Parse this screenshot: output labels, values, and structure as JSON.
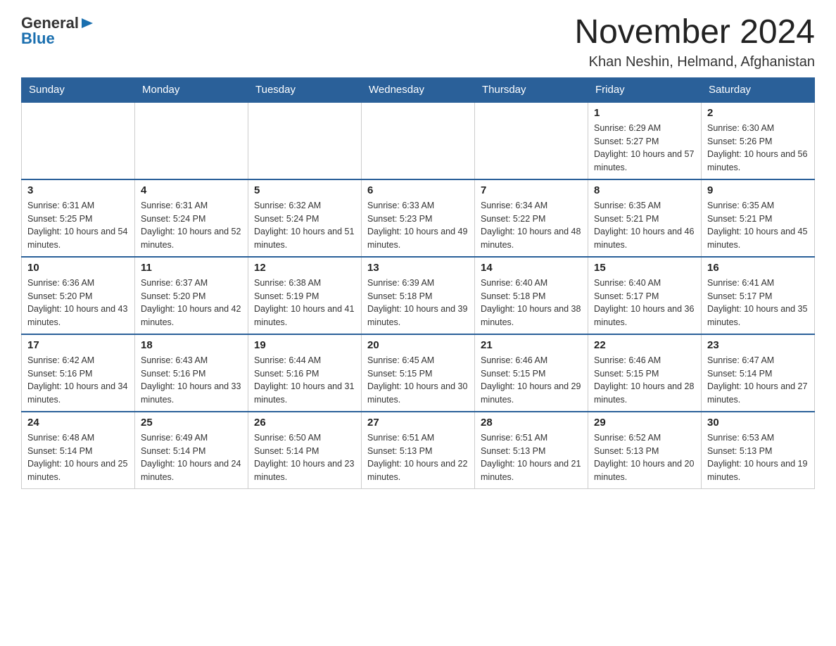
{
  "logo": {
    "general": "General",
    "arrow": "▶",
    "blue": "Blue"
  },
  "title": "November 2024",
  "subtitle": "Khan Neshin, Helmand, Afghanistan",
  "weekdays": [
    "Sunday",
    "Monday",
    "Tuesday",
    "Wednesday",
    "Thursday",
    "Friday",
    "Saturday"
  ],
  "weeks": [
    [
      {
        "day": "",
        "info": ""
      },
      {
        "day": "",
        "info": ""
      },
      {
        "day": "",
        "info": ""
      },
      {
        "day": "",
        "info": ""
      },
      {
        "day": "",
        "info": ""
      },
      {
        "day": "1",
        "info": "Sunrise: 6:29 AM\nSunset: 5:27 PM\nDaylight: 10 hours and 57 minutes."
      },
      {
        "day": "2",
        "info": "Sunrise: 6:30 AM\nSunset: 5:26 PM\nDaylight: 10 hours and 56 minutes."
      }
    ],
    [
      {
        "day": "3",
        "info": "Sunrise: 6:31 AM\nSunset: 5:25 PM\nDaylight: 10 hours and 54 minutes."
      },
      {
        "day": "4",
        "info": "Sunrise: 6:31 AM\nSunset: 5:24 PM\nDaylight: 10 hours and 52 minutes."
      },
      {
        "day": "5",
        "info": "Sunrise: 6:32 AM\nSunset: 5:24 PM\nDaylight: 10 hours and 51 minutes."
      },
      {
        "day": "6",
        "info": "Sunrise: 6:33 AM\nSunset: 5:23 PM\nDaylight: 10 hours and 49 minutes."
      },
      {
        "day": "7",
        "info": "Sunrise: 6:34 AM\nSunset: 5:22 PM\nDaylight: 10 hours and 48 minutes."
      },
      {
        "day": "8",
        "info": "Sunrise: 6:35 AM\nSunset: 5:21 PM\nDaylight: 10 hours and 46 minutes."
      },
      {
        "day": "9",
        "info": "Sunrise: 6:35 AM\nSunset: 5:21 PM\nDaylight: 10 hours and 45 minutes."
      }
    ],
    [
      {
        "day": "10",
        "info": "Sunrise: 6:36 AM\nSunset: 5:20 PM\nDaylight: 10 hours and 43 minutes."
      },
      {
        "day": "11",
        "info": "Sunrise: 6:37 AM\nSunset: 5:20 PM\nDaylight: 10 hours and 42 minutes."
      },
      {
        "day": "12",
        "info": "Sunrise: 6:38 AM\nSunset: 5:19 PM\nDaylight: 10 hours and 41 minutes."
      },
      {
        "day": "13",
        "info": "Sunrise: 6:39 AM\nSunset: 5:18 PM\nDaylight: 10 hours and 39 minutes."
      },
      {
        "day": "14",
        "info": "Sunrise: 6:40 AM\nSunset: 5:18 PM\nDaylight: 10 hours and 38 minutes."
      },
      {
        "day": "15",
        "info": "Sunrise: 6:40 AM\nSunset: 5:17 PM\nDaylight: 10 hours and 36 minutes."
      },
      {
        "day": "16",
        "info": "Sunrise: 6:41 AM\nSunset: 5:17 PM\nDaylight: 10 hours and 35 minutes."
      }
    ],
    [
      {
        "day": "17",
        "info": "Sunrise: 6:42 AM\nSunset: 5:16 PM\nDaylight: 10 hours and 34 minutes."
      },
      {
        "day": "18",
        "info": "Sunrise: 6:43 AM\nSunset: 5:16 PM\nDaylight: 10 hours and 33 minutes."
      },
      {
        "day": "19",
        "info": "Sunrise: 6:44 AM\nSunset: 5:16 PM\nDaylight: 10 hours and 31 minutes."
      },
      {
        "day": "20",
        "info": "Sunrise: 6:45 AM\nSunset: 5:15 PM\nDaylight: 10 hours and 30 minutes."
      },
      {
        "day": "21",
        "info": "Sunrise: 6:46 AM\nSunset: 5:15 PM\nDaylight: 10 hours and 29 minutes."
      },
      {
        "day": "22",
        "info": "Sunrise: 6:46 AM\nSunset: 5:15 PM\nDaylight: 10 hours and 28 minutes."
      },
      {
        "day": "23",
        "info": "Sunrise: 6:47 AM\nSunset: 5:14 PM\nDaylight: 10 hours and 27 minutes."
      }
    ],
    [
      {
        "day": "24",
        "info": "Sunrise: 6:48 AM\nSunset: 5:14 PM\nDaylight: 10 hours and 25 minutes."
      },
      {
        "day": "25",
        "info": "Sunrise: 6:49 AM\nSunset: 5:14 PM\nDaylight: 10 hours and 24 minutes."
      },
      {
        "day": "26",
        "info": "Sunrise: 6:50 AM\nSunset: 5:14 PM\nDaylight: 10 hours and 23 minutes."
      },
      {
        "day": "27",
        "info": "Sunrise: 6:51 AM\nSunset: 5:13 PM\nDaylight: 10 hours and 22 minutes."
      },
      {
        "day": "28",
        "info": "Sunrise: 6:51 AM\nSunset: 5:13 PM\nDaylight: 10 hours and 21 minutes."
      },
      {
        "day": "29",
        "info": "Sunrise: 6:52 AM\nSunset: 5:13 PM\nDaylight: 10 hours and 20 minutes."
      },
      {
        "day": "30",
        "info": "Sunrise: 6:53 AM\nSunset: 5:13 PM\nDaylight: 10 hours and 19 minutes."
      }
    ]
  ]
}
